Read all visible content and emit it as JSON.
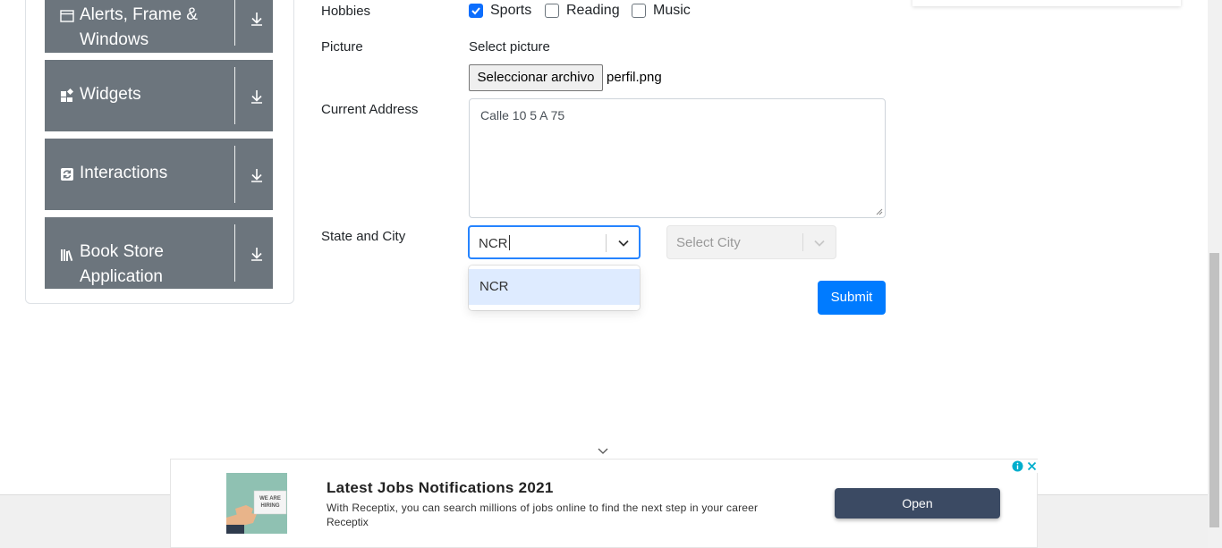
{
  "sidebar": {
    "groups": [
      {
        "icon": "window-icon",
        "title": "Alerts, Frame & Windows"
      },
      {
        "icon": "widgets-icon",
        "title": "Widgets"
      },
      {
        "icon": "interactions-icon",
        "title": "Interactions"
      },
      {
        "icon": "book-store-icon",
        "title": "Book Store Application"
      }
    ]
  },
  "form": {
    "hobbies_label": "Hobbies",
    "hobbies": [
      {
        "label": "Sports",
        "checked": true
      },
      {
        "label": "Reading",
        "checked": false
      },
      {
        "label": "Music",
        "checked": false
      }
    ],
    "picture_label": "Picture",
    "picture_prompt": "Select picture",
    "file_button": "Seleccionar archivo",
    "file_name": "perfil.png",
    "address_label": "Current Address",
    "address_value": "Calle 10 5 A 75",
    "state_city_label": "State and City",
    "state_input": "NCR",
    "state_option": "NCR",
    "city_placeholder": "Select City",
    "submit": "Submit"
  },
  "ad": {
    "title": "Latest Jobs Notifications 2021",
    "description": "With Receptix, you can search millions of jobs online to find the next step in your career",
    "brand": "Receptix",
    "cta": "Open",
    "image_text": "WE ARE HIRING"
  },
  "colors": {
    "sidebar_group": "#6c757d",
    "primary": "#007bff",
    "focus_border": "#2684ff",
    "option_highlight": "#deebff",
    "ad_button": "#3b4a63"
  }
}
